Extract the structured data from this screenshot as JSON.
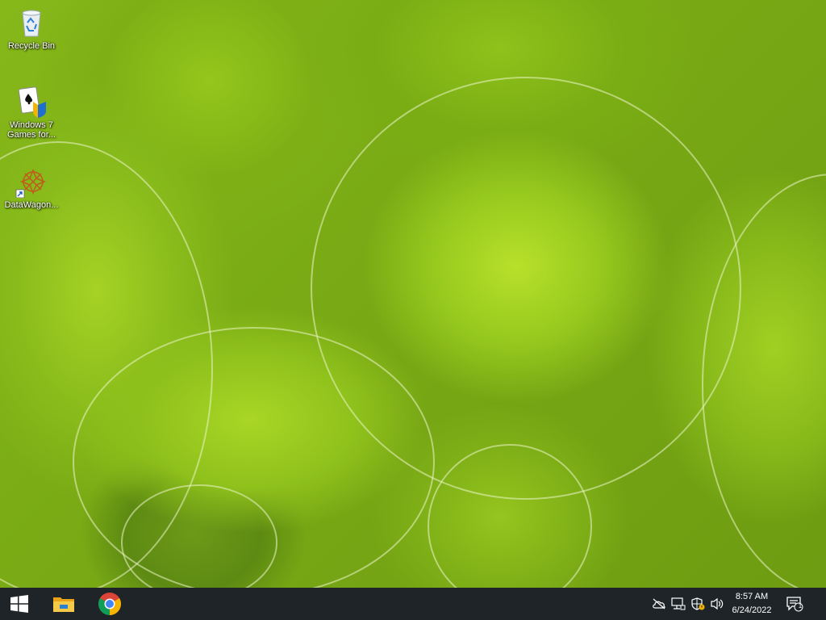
{
  "desktop": {
    "icons": [
      {
        "label": "Recycle Bin",
        "icon": "recycle-bin-icon"
      },
      {
        "label": "Windows 7 Games for...",
        "label_line1": "Windows 7",
        "label_line2": "Games for...",
        "icon": "solitaire-games-icon"
      },
      {
        "label": "DataWagon...",
        "icon": "datawagon-shortcut-icon"
      }
    ]
  },
  "taskbar": {
    "apps": [
      {
        "name": "Start",
        "icon": "windows-start-icon"
      },
      {
        "name": "File Explorer",
        "icon": "file-explorer-icon"
      },
      {
        "name": "Google Chrome",
        "icon": "chrome-icon"
      }
    ],
    "tray": {
      "icons": [
        "onedrive-offline-icon",
        "network-icon",
        "security-icon",
        "volume-icon"
      ],
      "time": "8:57 AM",
      "date": "6/24/2022",
      "notification_count": "1"
    }
  },
  "colors": {
    "taskbar": "#1f2428",
    "wallpaper_primary": "#96c91e"
  }
}
